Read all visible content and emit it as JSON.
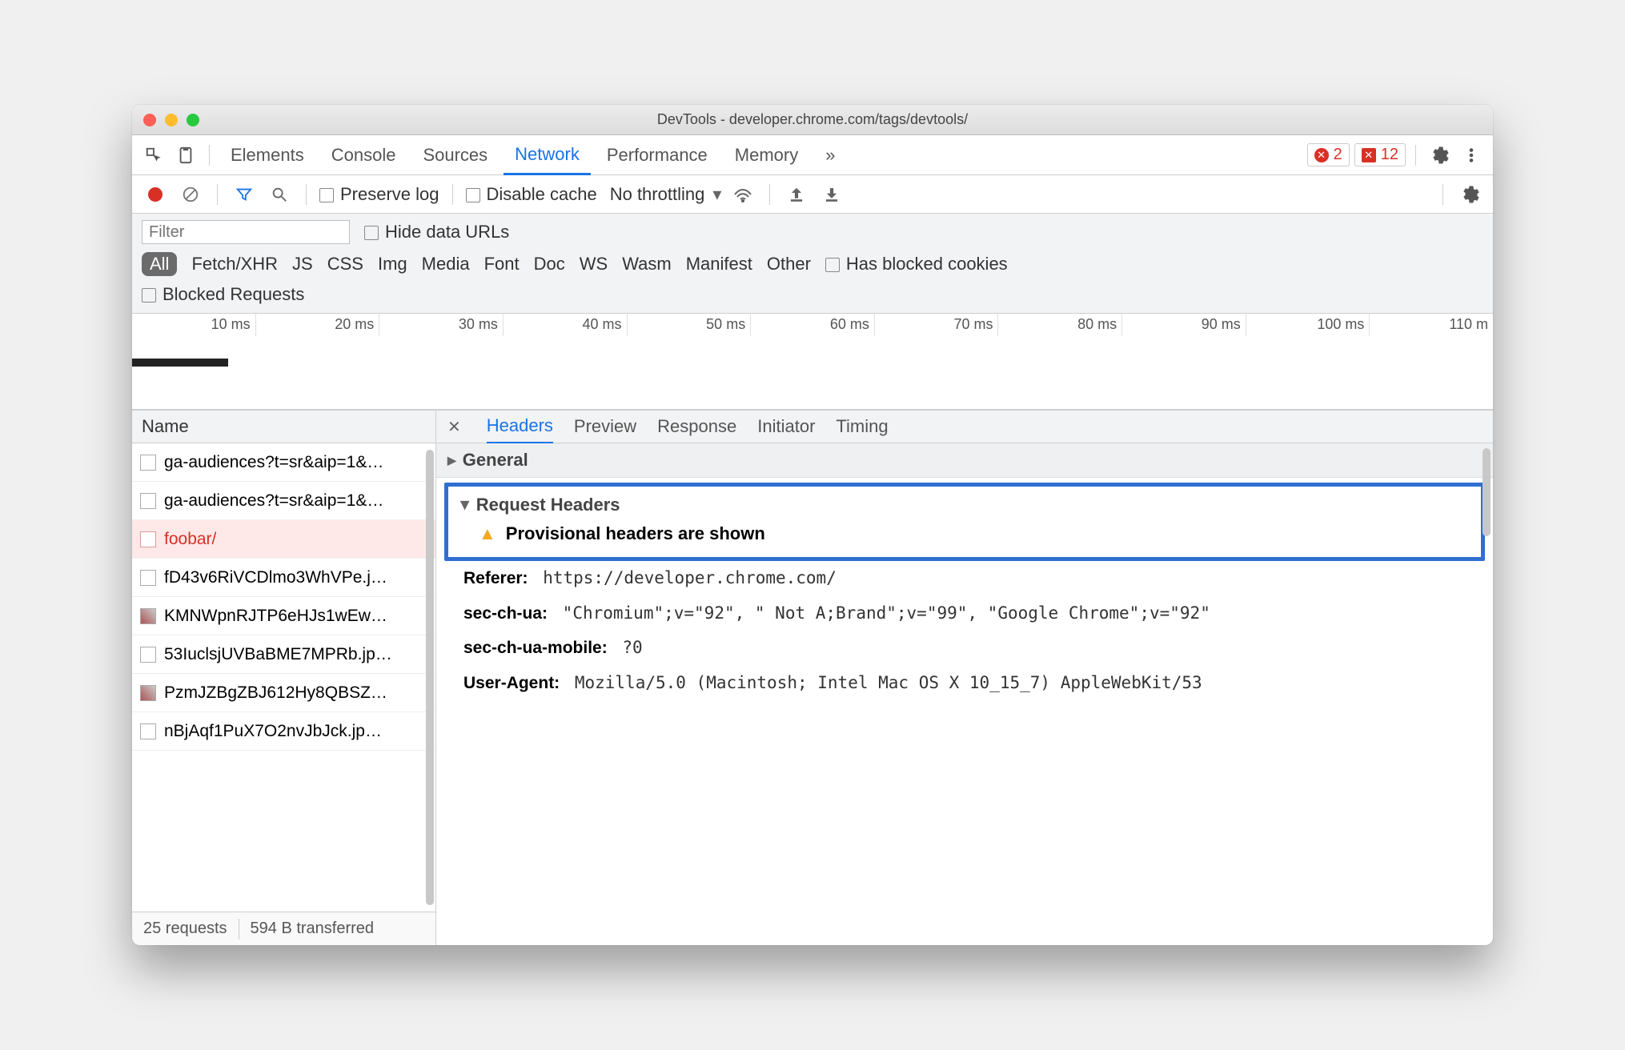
{
  "window": {
    "title": "DevTools - developer.chrome.com/tags/devtools/"
  },
  "topbar": {
    "tabs": [
      "Elements",
      "Console",
      "Sources",
      "Network",
      "Performance",
      "Memory"
    ],
    "active": "Network",
    "more_tabs_icon": "»",
    "errors_circle": "2",
    "errors_square": "12"
  },
  "toolbar": {
    "preserve_log": "Preserve log",
    "disable_cache": "Disable cache",
    "throttling": "No throttling"
  },
  "filters": {
    "placeholder": "Filter",
    "hide_data_urls": "Hide data URLs",
    "types": [
      "All",
      "Fetch/XHR",
      "JS",
      "CSS",
      "Img",
      "Media",
      "Font",
      "Doc",
      "WS",
      "Wasm",
      "Manifest",
      "Other"
    ],
    "has_blocked_cookies": "Has blocked cookies",
    "blocked_requests": "Blocked Requests"
  },
  "timeline": {
    "ticks": [
      "10 ms",
      "20 ms",
      "30 ms",
      "40 ms",
      "50 ms",
      "60 ms",
      "70 ms",
      "80 ms",
      "90 ms",
      "100 ms",
      "110 m"
    ]
  },
  "requests": {
    "col": "Name",
    "rows": [
      {
        "name": "ga-audiences?t=sr&aip=1&…",
        "err": false,
        "thumb": false
      },
      {
        "name": "ga-audiences?t=sr&aip=1&…",
        "err": false,
        "thumb": false
      },
      {
        "name": "foobar/",
        "err": true,
        "thumb": false
      },
      {
        "name": "fD43v6RiVCDlmo3WhVPe.j…",
        "err": false,
        "thumb": false
      },
      {
        "name": "KMNWpnRJTP6eHJs1wEw…",
        "err": false,
        "thumb": true
      },
      {
        "name": "53IuclsjUVBaBME7MPRb.jp…",
        "err": false,
        "thumb": false
      },
      {
        "name": "PzmJZBgZBJ612Hy8QBSZ…",
        "err": false,
        "thumb": true
      },
      {
        "name": "nBjAqf1PuX7O2nvJbJck.jp…",
        "err": false,
        "thumb": false
      }
    ],
    "status": {
      "count": "25 requests",
      "transferred": "594 B transferred"
    }
  },
  "detail": {
    "tabs": [
      "Headers",
      "Preview",
      "Response",
      "Initiator",
      "Timing"
    ],
    "active": "Headers",
    "general": "General",
    "req_headers": "Request Headers",
    "provisional": "Provisional headers are shown",
    "headers": [
      {
        "k": "Referer:",
        "v": "https://developer.chrome.com/"
      },
      {
        "k": "sec-ch-ua:",
        "v": "\"Chromium\";v=\"92\", \" Not A;Brand\";v=\"99\", \"Google Chrome\";v=\"92\""
      },
      {
        "k": "sec-ch-ua-mobile:",
        "v": "?0"
      },
      {
        "k": "User-Agent:",
        "v": "Mozilla/5.0 (Macintosh; Intel Mac OS X 10_15_7) AppleWebKit/53"
      }
    ]
  }
}
